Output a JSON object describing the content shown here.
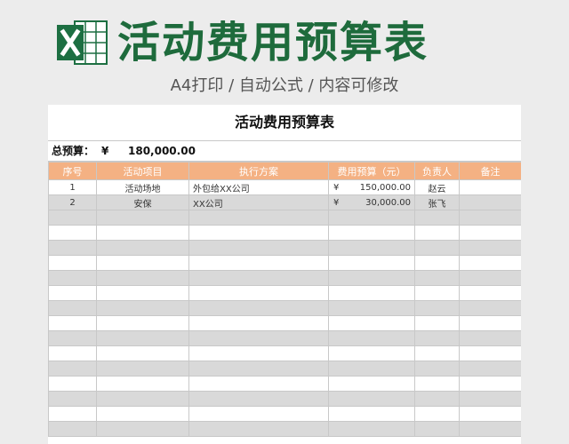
{
  "header": {
    "title": "活动费用预算表",
    "subtitle": "A4打印 / 自动公式 / 内容可修改"
  },
  "sheet": {
    "title": "活动费用预算表",
    "total_label": "总预算：",
    "total_currency": "¥",
    "total_value": "180,000.00",
    "columns": [
      "序号",
      "活动项目",
      "执行方案",
      "费用预算（元）",
      "负责人",
      "备注"
    ],
    "rows": [
      {
        "no": "1",
        "item": "活动场地",
        "plan": "外包给XX公司",
        "currency": "¥",
        "amount": "150,000.00",
        "owner": "赵云",
        "note": ""
      },
      {
        "no": "2",
        "item": "安保",
        "plan": "XX公司",
        "currency": "¥",
        "amount": "30,000.00",
        "owner": "张飞",
        "note": ""
      }
    ],
    "empty_rows": 15
  },
  "colors": {
    "header_bg": "#f4b183",
    "title_green": "#1e6b3c",
    "logo_green": "#1d6f42",
    "alt_row": "#d9d9d9"
  },
  "icons": {
    "logo": "excel-icon"
  }
}
